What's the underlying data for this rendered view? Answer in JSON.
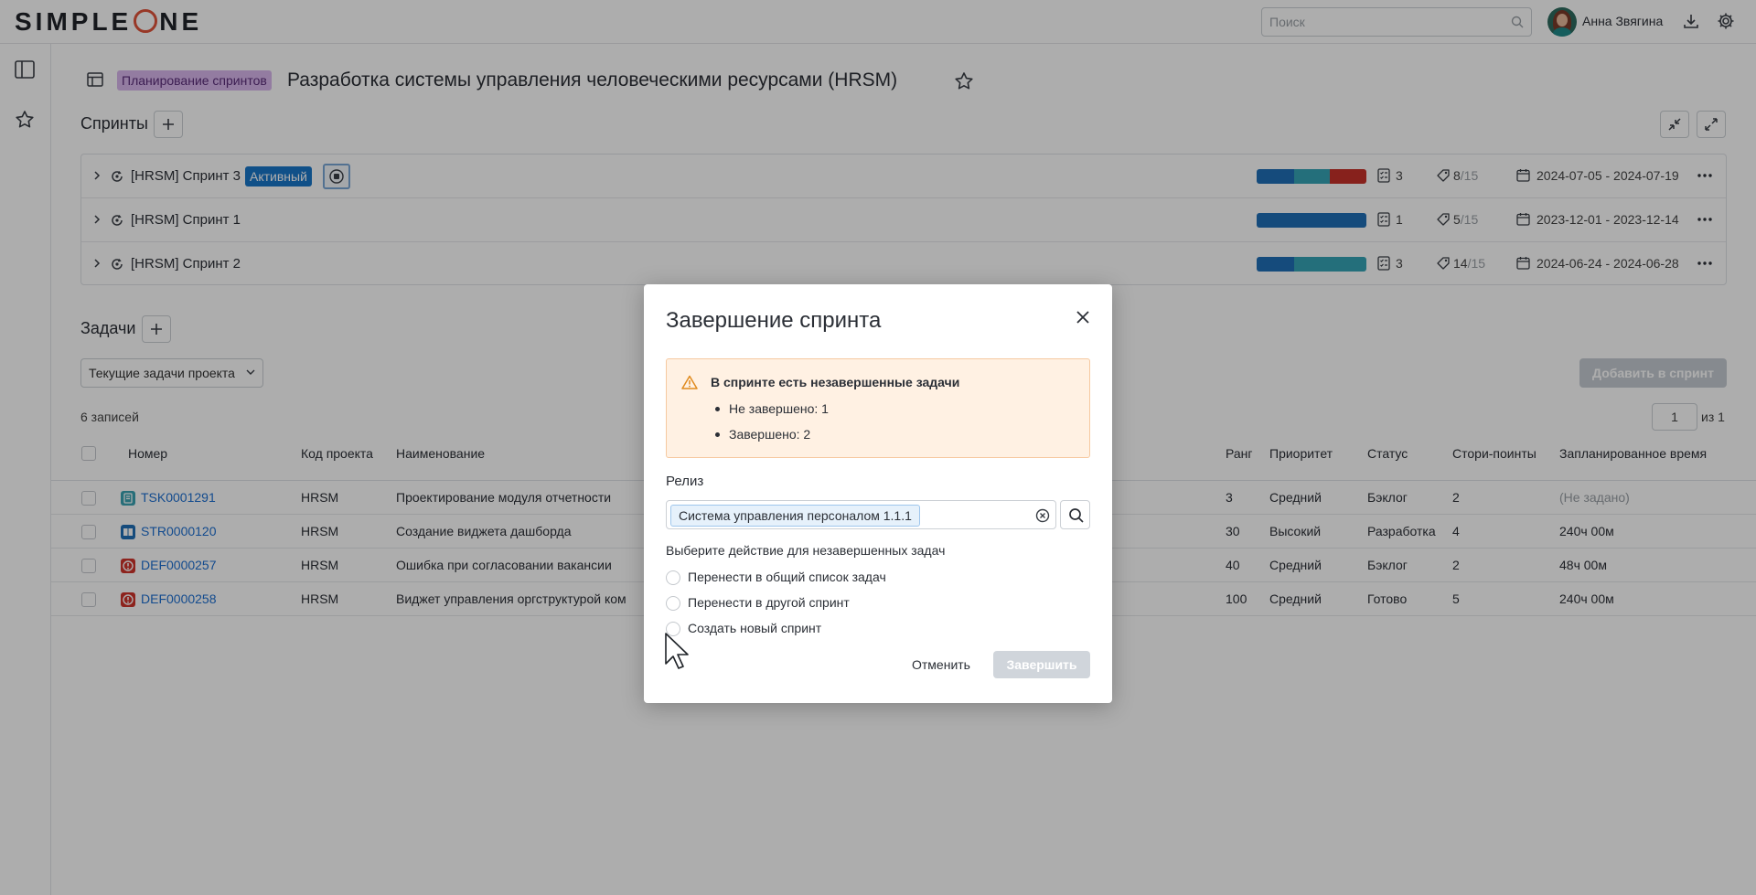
{
  "app": {
    "logo_left": "SIMPLE",
    "logo_right": "NE"
  },
  "header": {
    "search_placeholder": "Поиск",
    "user_name": "Анна Звягина"
  },
  "breadcrumb": {
    "tag": "Планирование спринтов",
    "title": "Разработка системы управления человеческими ресурсами (HRSM)"
  },
  "sprints": {
    "title": "Спринты",
    "items": [
      {
        "name": "[HRSM] Спринт 3",
        "badge": "Активный",
        "tasks": "3",
        "points_done": "8",
        "points_total": "/15",
        "dates": "2024-07-05 - 2024-07-19",
        "progress": [
          {
            "color": "#1f6fb7",
            "share": 0.34
          },
          {
            "color": "#35a4b6",
            "share": 0.33
          },
          {
            "color": "#c8312a",
            "share": 0.33
          }
        ]
      },
      {
        "name": "[HRSM] Спринт 1",
        "badge": "",
        "tasks": "1",
        "points_done": "5",
        "points_total": "/15",
        "dates": "2023-12-01 - 2023-12-14",
        "progress": [
          {
            "color": "#1f6fb7",
            "share": 1.0
          }
        ]
      },
      {
        "name": "[HRSM] Спринт 2",
        "badge": "",
        "tasks": "3",
        "points_done": "14",
        "points_total": "/15",
        "dates": "2024-06-24 - 2024-06-28",
        "progress": [
          {
            "color": "#1f6fb7",
            "share": 0.34
          },
          {
            "color": "#35a4b6",
            "share": 0.66
          }
        ]
      }
    ]
  },
  "tasks": {
    "title": "Задачи",
    "filter": "Текущие задачи проекта",
    "count": "6 записей",
    "add_to_sprint": "Добавить в спринт",
    "page": "1",
    "page_of": "из 1",
    "columns": [
      "Номер",
      "Код проекта",
      "Наименование",
      "Ранг",
      "Приоритет",
      "Статус",
      "Стори-поинты",
      "Запланированное время"
    ],
    "rows": [
      {
        "number": "TSK0001291",
        "type": "task",
        "type_color": "#3aa3b3",
        "project": "HRSM",
        "name": "Проектирование модуля отчетности",
        "rank": "3",
        "priority": "Средний",
        "status": "Бэклог",
        "points": "2",
        "time": "(Не задано)",
        "time_muted": true
      },
      {
        "number": "STR0000120",
        "type": "story",
        "type_color": "#1f6fb7",
        "project": "HRSM",
        "name": "Создание виджета дашборда",
        "rank": "30",
        "priority": "Высокий",
        "status": "Разработка",
        "points": "4",
        "time": "240ч 00м",
        "time_muted": false
      },
      {
        "number": "DEF0000257",
        "type": "defect",
        "type_color": "#d0342c",
        "project": "HRSM",
        "name": "Ошибка при согласовании вакансии",
        "rank": "40",
        "priority": "Средний",
        "status": "Бэклог",
        "points": "2",
        "time": "48ч 00м",
        "time_muted": false
      },
      {
        "number": "DEF0000258",
        "type": "defect",
        "type_color": "#d0342c",
        "project": "HRSM",
        "name": "Виджет управления оргструктурой ком",
        "rank": "100",
        "priority": "Средний",
        "status": "Готово",
        "points": "5",
        "time": "240ч 00м",
        "time_muted": false
      }
    ]
  },
  "modal": {
    "title": "Завершение спринта",
    "warning_title": "В спринте есть незавершенные задачи",
    "warning_items": [
      "Не завершено: 1",
      "Завершено: 2"
    ],
    "release_label": "Релиз",
    "release_value": "Система управления персоналом 1.1.1",
    "action_label": "Выберите действие для незавершенных задач",
    "options": [
      "Перенести в общий список задач",
      "Перенести в другой спринт",
      "Создать новый спринт"
    ],
    "cancel": "Отменить",
    "finish": "Завершить"
  }
}
